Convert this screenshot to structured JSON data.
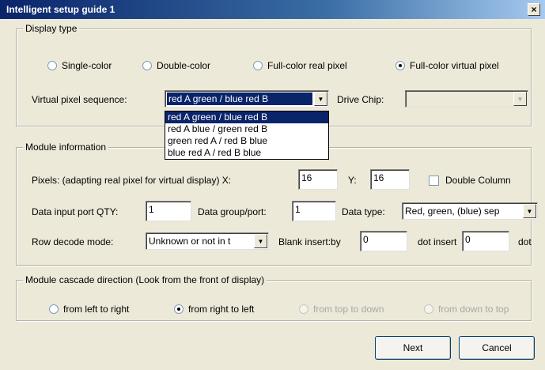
{
  "window": {
    "title": "Intelligent setup guide 1",
    "close_glyph": "×"
  },
  "display_type": {
    "legend": "Display type",
    "options": [
      {
        "label": "Single-color",
        "checked": false
      },
      {
        "label": "Double-color",
        "checked": false
      },
      {
        "label": "Full-color real pixel",
        "checked": false
      },
      {
        "label": "Full-color virtual pixel",
        "checked": true
      }
    ],
    "virtual_pixel_label": "Virtual pixel sequence:",
    "virtual_pixel_value": "red A green / blue red B",
    "drive_chip_label": "Drive Chip:",
    "drive_chip_value": "",
    "dropdown_options": [
      {
        "label": "red A green / blue red B",
        "selected": true
      },
      {
        "label": "red A blue / green red B",
        "selected": false
      },
      {
        "label": " green red A / red B  blue",
        "selected": false
      },
      {
        "label": "blue red A / red B  blue",
        "selected": false
      }
    ]
  },
  "module_info": {
    "legend": "Module information",
    "pixels_label": "Pixels: (adapting real pixel for virtual display) X:",
    "x_value": "16",
    "y_label": "Y:",
    "y_value": "16",
    "double_column_label": "Double Column",
    "double_column_checked": false,
    "data_input_label": "Data input port QTY:",
    "data_input_value": "1",
    "data_group_label": "Data group/port:",
    "data_group_value": "1",
    "data_type_label": "Data type:",
    "data_type_value": "Red, green, (blue) sep",
    "row_decode_label": "Row decode mode:",
    "row_decode_value": "Unknown or not in t",
    "blank_insert_label": "Blank insert:by",
    "blank_insert_value": "0",
    "dot_insert_label": "dot insert",
    "dot_insert_value": "0",
    "dot_label": "dot"
  },
  "cascade": {
    "legend": "Module cascade direction (Look from the front of display)",
    "options": [
      {
        "label": "from left to right",
        "checked": false,
        "disabled": false
      },
      {
        "label": "from right to left",
        "checked": true,
        "disabled": false
      },
      {
        "label": "from top to down",
        "checked": false,
        "disabled": true
      },
      {
        "label": "from down to top",
        "checked": false,
        "disabled": true
      }
    ]
  },
  "buttons": {
    "next": "Next",
    "cancel": "Cancel"
  },
  "icons": {
    "dropdown_arrow": "▼"
  }
}
